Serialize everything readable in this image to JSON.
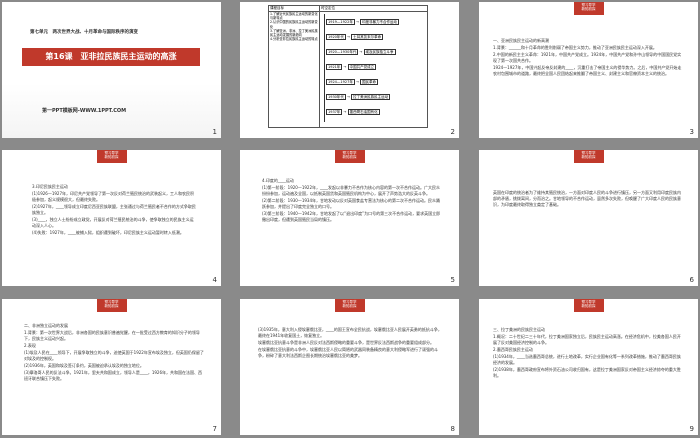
{
  "slides": {
    "s1": {
      "unit": "第七单元　两次世界大战、十月革命与国际秩序的演变",
      "title": "第16课　亚非拉民族民主运动的高涨",
      "footer": "第一PPT模板网-WWW.1PPT.COM",
      "num": "1"
    },
    "s2": {
      "table_header_left": "课程目标",
      "table_header_right": "时空定位",
      "goals": [
        "1.了解近代民族民主运动的新变化与新特点",
        "2.认识中国的民族民主运动的新变化",
        "3.了解亚洲、非洲、拉丁美洲民族民主运动发展的新趋向",
        "4.分析亚非拉民族民主运动的特点"
      ],
      "timeline": [
        {
          "year": "1919—1922年",
          "event": "印度非暴力不合作运动"
        },
        {
          "year": "1920年代",
          "event": "土耳其凯末尔革命"
        },
        {
          "year": "1920—1930年代",
          "event": "埃及民族独立斗争"
        },
        {
          "year": "1921年",
          "event": "中国共产党成立"
        },
        {
          "year": "1924—1927年",
          "event": "国民革命"
        },
        {
          "year": "1930年代",
          "event": "拉丁美洲民族民主运动"
        },
        {
          "year": "1937年",
          "event": "墨西哥石油国有化"
        }
      ],
      "num": "2"
    },
    "s3": {
      "tag": [
        "预习导学",
        "新知初探"
      ],
      "heading": "一、亚洲民族民主运动的新高潮",
      "lines": [
        "1.背景：______和十月革命的胜利削弱了帝国主义势力，推动了亚洲民族民主运动深入开展。",
        "2.中国的新民主主义革命：1921年，中国共产党成立。1924年，中国共产党和孙中山领导的中国国民党实现了第一次国共合作。",
        "1924—1927年，中国兴起反帝反封建的____，沉重打击了帝国主义的侵华势力。之后，中国共产党开始走农村包围城市的道路，最终把全国人民团结起来推翻了帝国主义、封建主义和官僚资本主义的统治。"
      ],
      "num": "3"
    },
    "s4": {
      "tag": [
        "预习导学",
        "新知初探"
      ],
      "lines": [
        "3.印尼民族民主运动",
        "(1)1926—1927年，印尼共产党领导了第一次反对荷兰殖民统治的武装起义，工人和农民积极参加，起义规模很大，但最终失败。",
        "(2)1927年，____领导成立印度尼西亚民族联盟，主张通过与荷兰殖民者不合作的方式争取民族独立。",
        "(3)____，独立人士纷纷成立政党，开展反对荷兰殖民统治的斗争，使争取独立的民族主义运动深入人心。",
        "(4)失败：1927年，____被捕入狱，组织遭到破坏，印尼民族主义运动暂时转入低潮。"
      ],
      "num": "4"
    },
    "s5": {
      "tag": [
        "预习导学",
        "新知初探"
      ],
      "lines": [
        "4.印度的____运动",
        "(1)第一阶段：1920—1922年，____发起以非暴力不合作为核心内容的第一次不合作运动。广大民众纷纷参加，运动遍及全国，以抵制英国货和英国殖民机构为中心，展开了声势浩大的反英斗争。",
        "(2)第二阶段：1930—1934年，甘地发动以反对英国食盐专营法为核心的第二次不合作运动。民众踊跃参加，并提出了印度完全独立的口号。",
        "(3)第三阶段：1940—1942年，甘地发起了以“退出印度”为口号的第三次不合作运动，要求英国立即撤出印度，但遭到英国殖民当局的镇压。"
      ],
      "num": "5"
    },
    "s6": {
      "tag": [
        "预习导学",
        "新知初探"
      ],
      "lines": [
        "英国在印度的统治者为了维持其殖民统治，一方面对印度人民的斗争进行镇压，另一方面又利用印度民族内部的矛盾，挑拨离间，分而治之。甘地领导的不合作运动，虽然多次失败，但唤醒了广大印度人民的民族意识，为印度最终取得独立奠定了基础。"
      ],
      "num": "6"
    },
    "s7": {
      "tag": [
        "预习导学",
        "新知初探"
      ],
      "heading": "二、非洲独立运动的发展",
      "lines": [
        "1.背景：第一次世界大战后，非洲各国的民族意识普遍觉醒，在一批受过西方教育的知识分子的领导下，民族主义运动兴起。",
        "2.表现",
        "(1)埃及人民在____领导下，开展争取独立的斗争，迫使英国于1922年宣布埃及独立，但英国仍保留了对埃及的控制权。",
        "(2)1936年，英国和埃及签订条约，英国被迫承认埃及的独立地位。",
        "(3)摩洛哥人民的反法斗争。1921年，里夫共和国成立，领导人是____，1926年，共和国在法国、西班牙联合镇压下失败。"
      ],
      "num": "7"
    },
    "s8": {
      "tag": [
        "预习导学",
        "新知初探"
      ],
      "lines": [
        "(3)1935年，意大利入侵埃塞俄比亚，____的国王宣布全民抗战，埃塞俄比亚人民展开英勇的抵抗斗争，最终在1941年收复国土，恢复独立。",
        "埃塞俄比亚抗意斗争是非洲人民反对法西斯侵略的重要斗争，是世界反法西斯战争的重要组成部分。",
        "在埃塞俄比亚抗意的斗争中，埃塞俄比亚人民以简陋的武器同装备精良的意大利侵略军进行了顽强的斗争，粉碎了意大利法西斯企图长期统治埃塞俄比亚的美梦。"
      ],
      "num": "8"
    },
    "s9": {
      "tag": [
        "预习导学",
        "新知初探"
      ],
      "heading": "三、拉丁美洲的民族民主运动",
      "lines": [
        "1.概况：二十世纪二三十年代，拉丁美洲国家独立后，民族民主运动高涨。在经济危机中，拉美各国人民开展了反对美国经济控制的斗争。",
        "2.墨西哥民族民主运动",
        "(1)1934年，____当选墨西哥总统，进行土地改革，实行企业国有化等一系列改革措施，推动了墨西哥民族经济的发展。",
        "(2)1938年，墨西哥政府宣布将外资石油公司收归国有，这是拉丁美洲国家反对帝国主义经济掠夺的重大胜利。"
      ],
      "num": "9"
    }
  }
}
